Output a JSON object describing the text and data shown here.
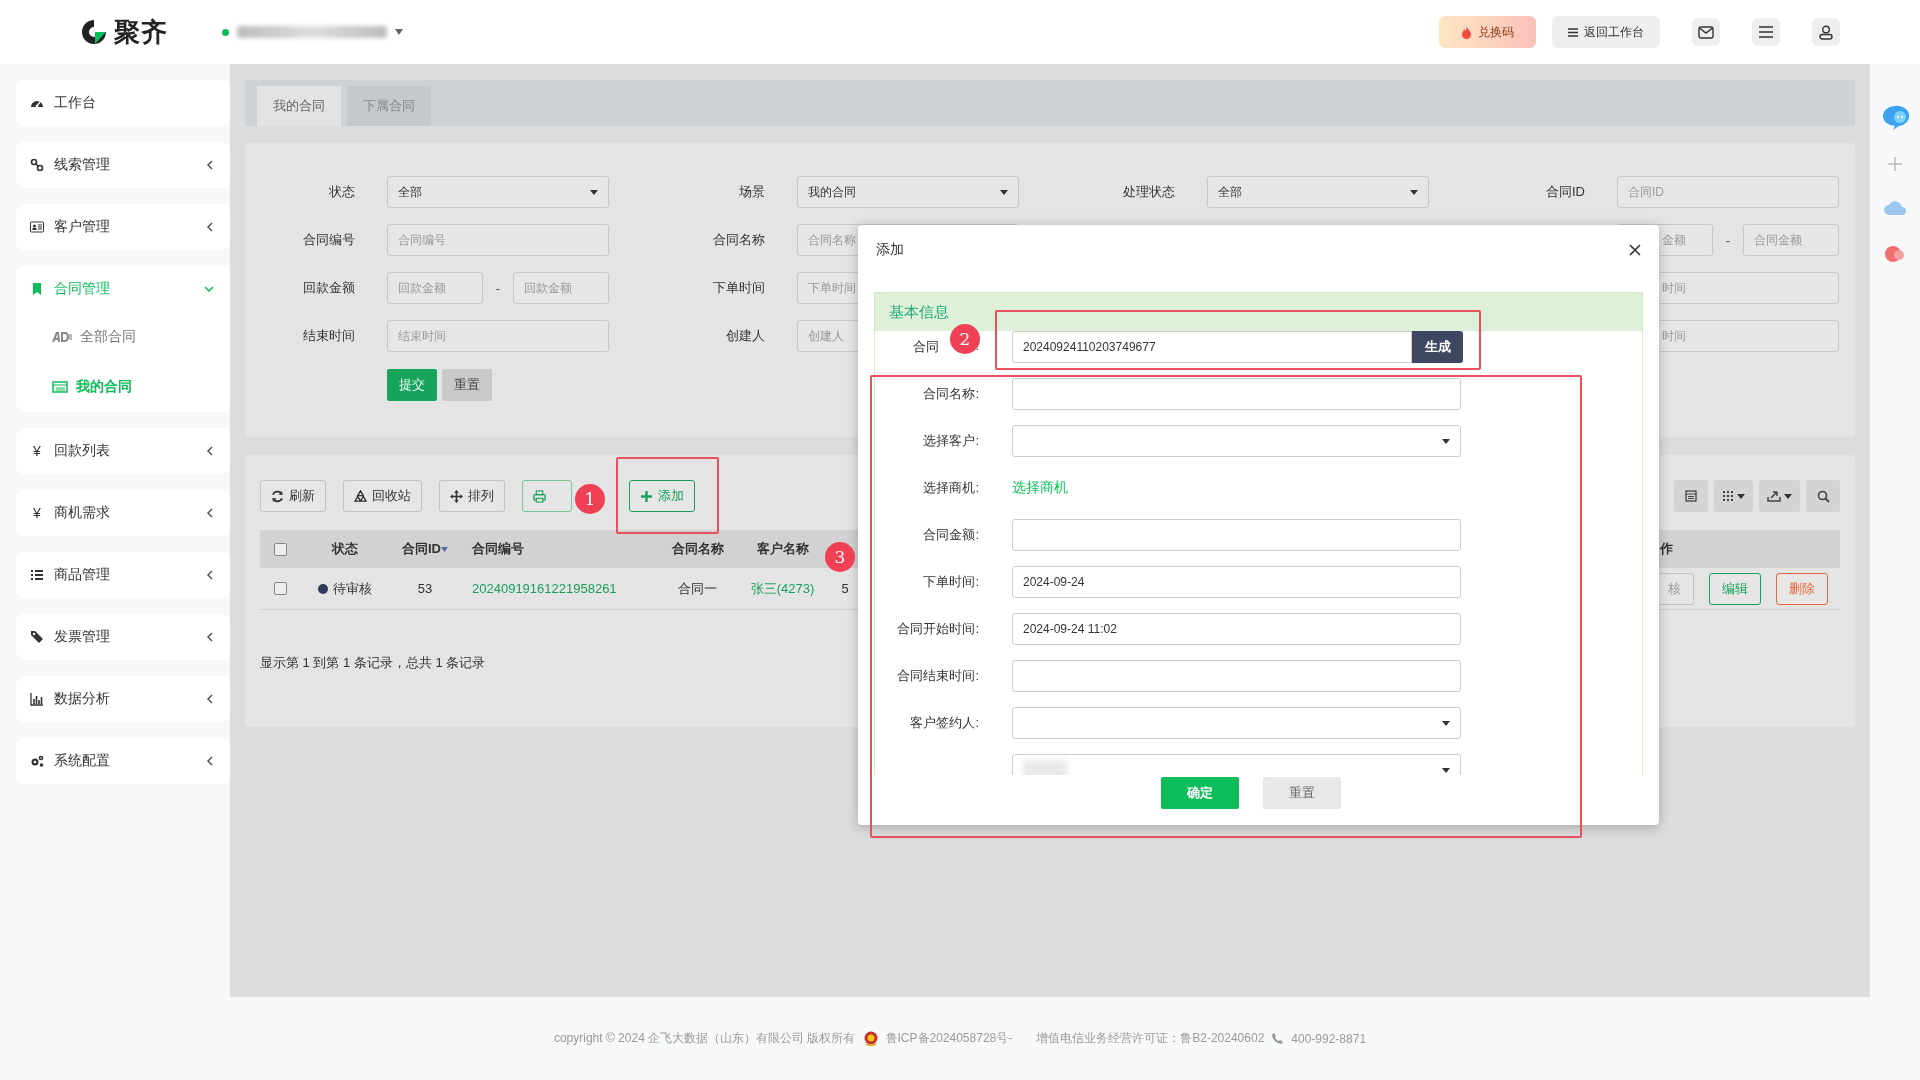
{
  "header": {
    "logo": "聚齐",
    "redeem_button": "兑换码",
    "workbench_button": "返回工作台"
  },
  "sidebar": {
    "items": [
      {
        "label": "工作台",
        "kind": "link"
      },
      {
        "label": "线索管理",
        "kind": "group",
        "expanded": false
      },
      {
        "label": "客户管理",
        "kind": "group",
        "expanded": false
      },
      {
        "label": "合同管理",
        "kind": "group",
        "expanded": true,
        "children": [
          {
            "label": "全部合同",
            "selected": false
          },
          {
            "label": "我的合同",
            "selected": true
          }
        ]
      },
      {
        "label": "回款列表",
        "kind": "group",
        "expanded": false,
        "icon_char": "¥"
      },
      {
        "label": "商机需求",
        "kind": "group",
        "expanded": false,
        "icon_char": "¥"
      },
      {
        "label": "商品管理",
        "kind": "group",
        "expanded": false
      },
      {
        "label": "发票管理",
        "kind": "group",
        "expanded": false
      },
      {
        "label": "数据分析",
        "kind": "group",
        "expanded": false
      },
      {
        "label": "系统配置",
        "kind": "group",
        "expanded": false
      }
    ]
  },
  "tabs": [
    {
      "label": "我的合同",
      "selected": true
    },
    {
      "label": "下属合同",
      "selected": false
    }
  ],
  "filters": {
    "fields": [
      {
        "kind": "select",
        "label": "状态",
        "value": "全部"
      },
      {
        "kind": "select",
        "label": "场景",
        "value": "我的合同"
      },
      {
        "kind": "select",
        "label": "处理状态",
        "value": "全部"
      },
      {
        "kind": "input",
        "label": "合同ID",
        "placeholder": "合同ID"
      },
      {
        "kind": "input",
        "label": "合同编号",
        "placeholder": "合同编号"
      },
      {
        "kind": "input",
        "label": "合同名称",
        "placeholder": "合同名称"
      },
      {
        "kind": "covered"
      },
      {
        "kind": "cut_range",
        "placeholders": [
          "金额",
          "合同金额"
        ],
        "separator": "-"
      },
      {
        "kind": "range",
        "label": "回款金额",
        "placeholders": [
          "回款金额",
          "回款金额"
        ],
        "separator": "-"
      },
      {
        "kind": "input",
        "label": "下单时间",
        "placeholder": "下单时间"
      },
      {
        "kind": "covered"
      },
      {
        "kind": "cut_input",
        "placeholder": "时间"
      },
      {
        "kind": "input",
        "label": "结束时间",
        "placeholder": "结束时间"
      },
      {
        "kind": "input",
        "label": "创建人",
        "placeholder": "创建人"
      },
      {
        "kind": "covered"
      },
      {
        "kind": "cut_input",
        "placeholder": "时间"
      }
    ],
    "submit": "提交",
    "reset": "重置"
  },
  "table": {
    "toolbar": [
      {
        "kind": "refresh",
        "label": "刷新"
      },
      {
        "kind": "recycle",
        "label": "回收站"
      },
      {
        "kind": "arrange",
        "label": "排列"
      },
      {
        "kind": "print"
      },
      {
        "kind": "add",
        "label": "添加"
      }
    ],
    "select_all_checked": false,
    "columns": [
      {
        "label": "状态",
        "sorted": false
      },
      {
        "label": "合同ID",
        "sorted": true
      },
      {
        "label": "合同编号",
        "sorted": false
      },
      {
        "label": "合同名称",
        "sorted": false
      },
      {
        "label": "客户名称",
        "sorted": false
      }
    ],
    "action_header": "作",
    "rows": [
      {
        "checked": false,
        "status": "待审核",
        "id": "53",
        "number": "20240919161221958261",
        "name": "合同一",
        "customer": "张三(4273)",
        "column_7": "5",
        "actions": [
          {
            "kind": "cut",
            "label": "核"
          },
          {
            "kind": "edit",
            "label": "编辑"
          },
          {
            "kind": "delete",
            "label": "删除"
          }
        ]
      }
    ],
    "pagination": "显示第 1 到第 1 条记录，总共 1 条记录"
  },
  "dialog": {
    "title": "添加",
    "section": "基本信息",
    "fields": [
      {
        "kind": "code",
        "label": "合同",
        "label_suffix": ":",
        "value": "20240924110203749677",
        "button": "生成"
      },
      {
        "kind": "input",
        "label": "合同名称:"
      },
      {
        "kind": "select",
        "label": "选择客户:"
      },
      {
        "kind": "link",
        "label": "选择商机:",
        "link": "选择商机"
      },
      {
        "kind": "input",
        "label": "合同金额:"
      },
      {
        "kind": "input",
        "label": "下单时间:",
        "value": "2024-09-24"
      },
      {
        "kind": "input",
        "label": "合同开始时间:",
        "value": "2024-09-24 11:02"
      },
      {
        "kind": "input",
        "label": "合同结束时间:"
      },
      {
        "kind": "select",
        "label": "客户签约人:"
      },
      {
        "kind": "blurred_select"
      }
    ],
    "confirm": "确定",
    "reset": "重置"
  },
  "annotations": [
    {
      "label": "1"
    },
    {
      "label": "2"
    },
    {
      "label": "3"
    }
  ],
  "footer": {
    "copyright": "copyright © 2024 企飞大数据（山东）有限公司 版权所有",
    "icp": "鲁ICP备2024058728号-",
    "license": "增值电信业务经营许可证：鲁B2-20240602",
    "phone": "400-992-8871"
  }
}
